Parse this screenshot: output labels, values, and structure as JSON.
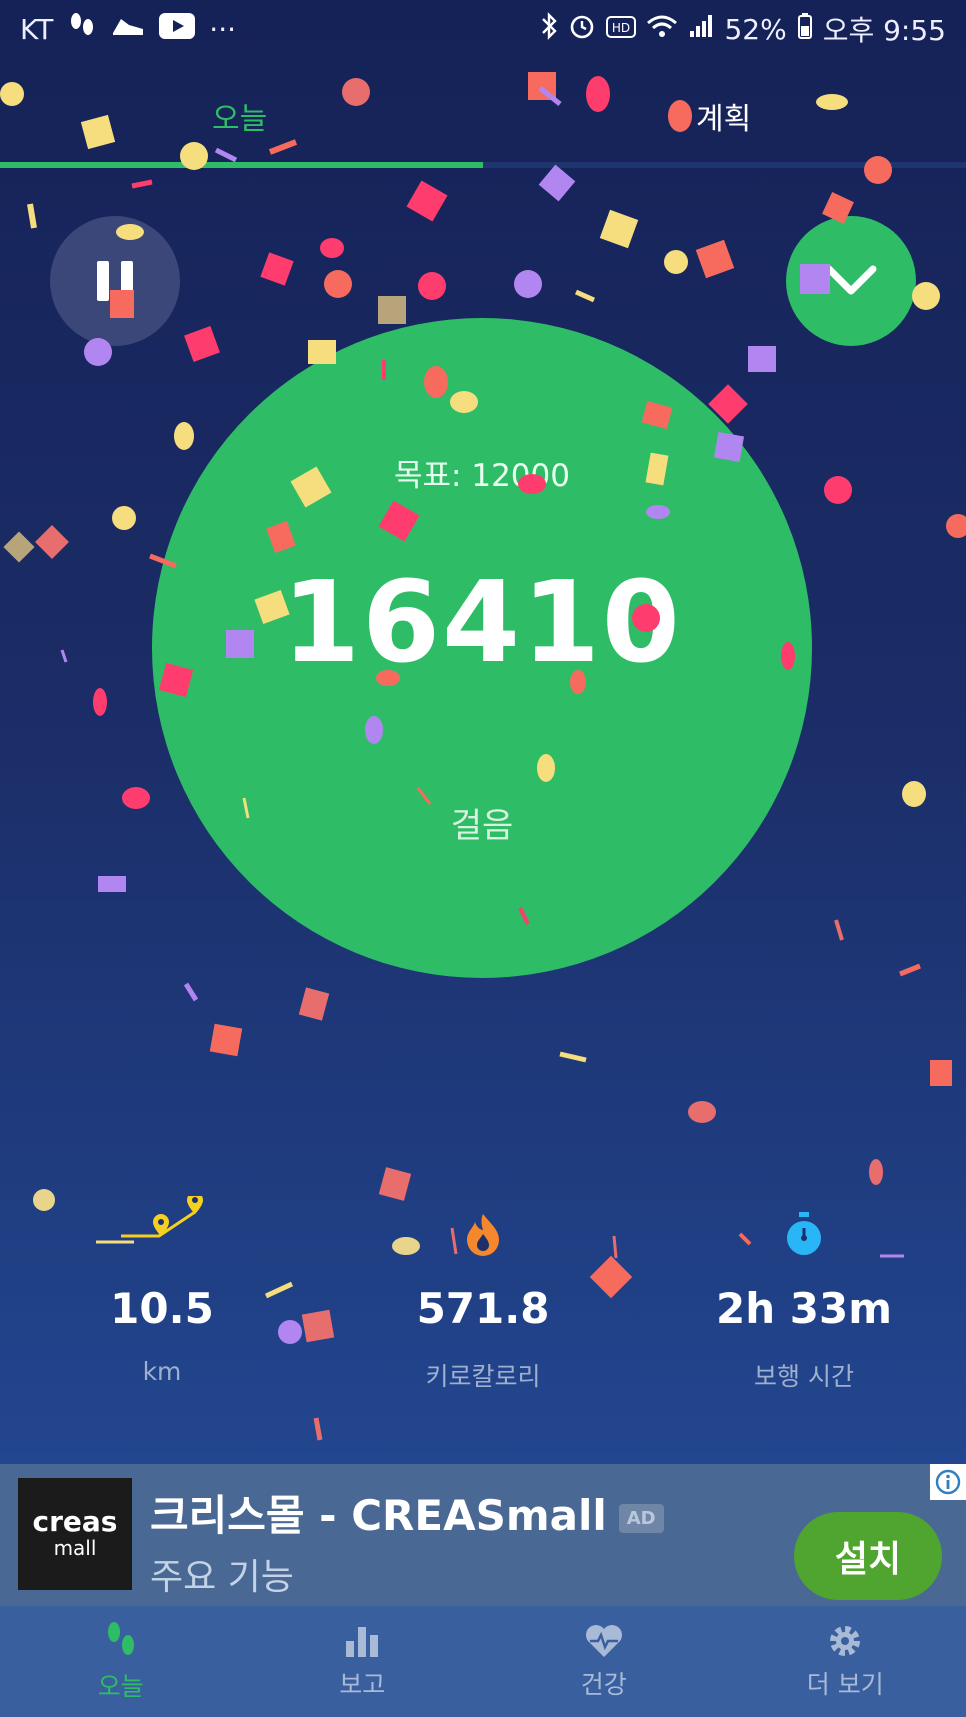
{
  "status_bar": {
    "carrier": "KT",
    "battery": "52%",
    "time": "오후 9:55",
    "left_icons": [
      "footsteps-icon",
      "shoe-icon",
      "youtube-icon",
      "more-icon"
    ],
    "right_icons": [
      "bluetooth-icon",
      "alarm-icon",
      "hd-icon",
      "wifi-icon",
      "signal-icon",
      "battery-icon"
    ]
  },
  "tabs": [
    {
      "label": "오늘",
      "active": true
    },
    {
      "label": "계획",
      "active": false
    }
  ],
  "main": {
    "goal_text": "목표: 12000",
    "steps": "16410",
    "steps_label": "걸음"
  },
  "stats": [
    {
      "value": "10.5",
      "label": "km",
      "icon": "route-pin-icon"
    },
    {
      "value": "571.8",
      "label": "키로칼로리",
      "icon": "flame-icon"
    },
    {
      "value": "2h 33m",
      "label": "보행 시간",
      "icon": "stopwatch-icon"
    }
  ],
  "ad": {
    "thumb_line1": "creas",
    "thumb_line2": "mall",
    "title": "크리스몰 - CREASmall",
    "badge": "AD",
    "subtitle": "주요 기능",
    "install": "설치"
  },
  "bottom_nav": [
    {
      "label": "오늘",
      "icon": "footsteps-icon",
      "active": true
    },
    {
      "label": "보고",
      "icon": "bar-chart-icon",
      "active": false
    },
    {
      "label": "건강",
      "icon": "heart-pulse-icon",
      "active": false
    },
    {
      "label": "더 보기",
      "icon": "gear-icon",
      "active": false
    }
  ],
  "colors": {
    "accent": "#2ebd66",
    "background_top": "#152257",
    "background_bottom": "#2a56a6",
    "confetti": [
      "#ff3c6e",
      "#f76b5e",
      "#f6de7e",
      "#b286f0",
      "#e86d6d"
    ]
  }
}
